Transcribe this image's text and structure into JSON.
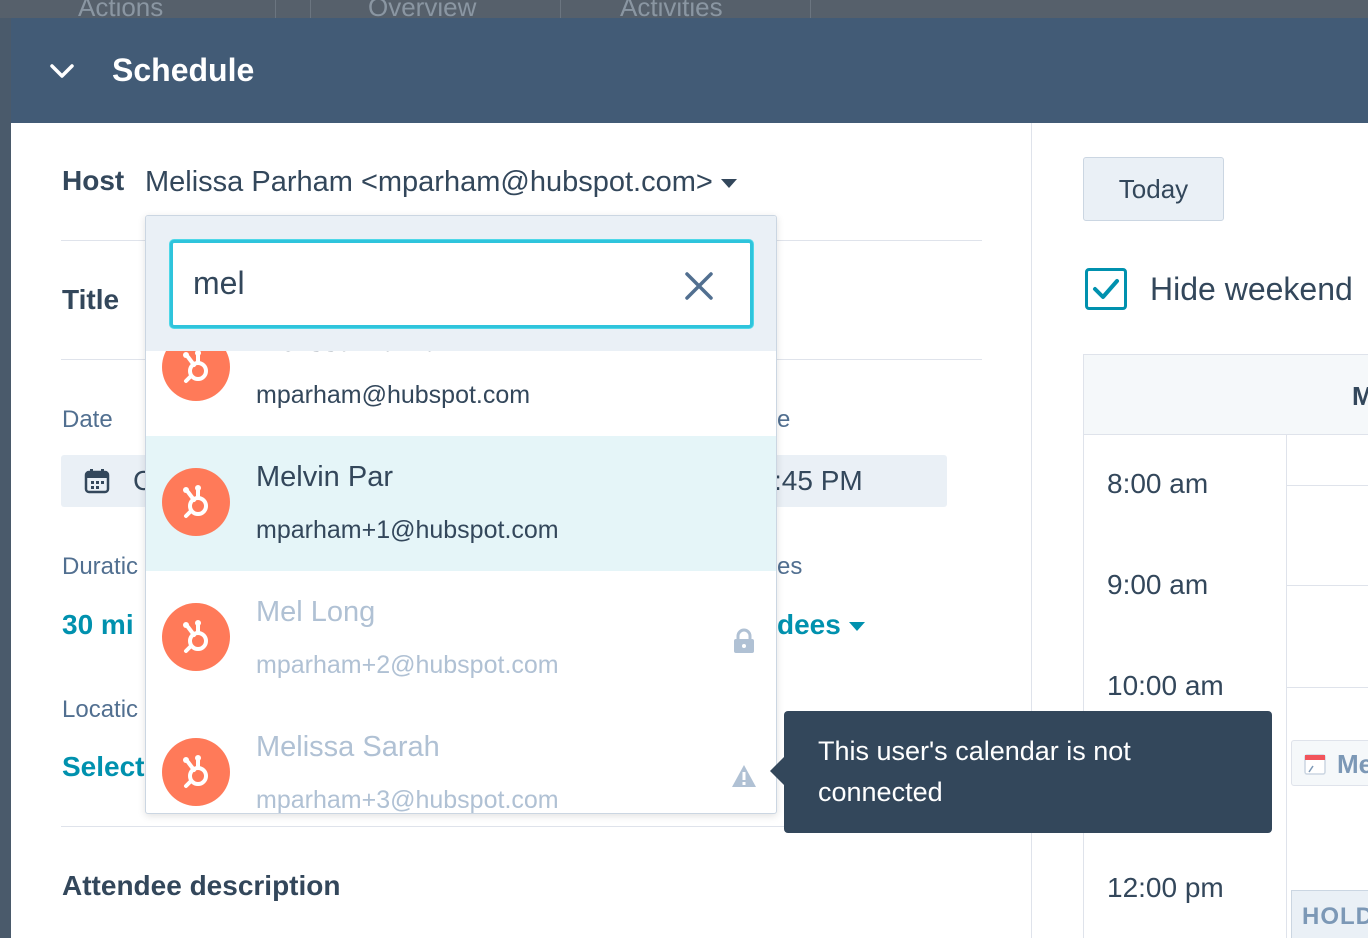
{
  "background_tabs": [
    "Actions",
    "Overview",
    "Activities"
  ],
  "modal": {
    "title": "Schedule",
    "collapse_icon": "chevron-down-icon"
  },
  "form": {
    "host_label": "Host",
    "host_value": "Melissa Parham <mparham@hubspot.com>",
    "title_label": "Title",
    "date_label": "Date",
    "time_label_partial": "e",
    "date_value_partial": "C",
    "time_value_partial": ":45 PM",
    "duration_label": "Duratic",
    "duration_value": "30 mi",
    "attendees_label_partial": "es",
    "attendees_value_partial": "dees",
    "location_label": "Locatic",
    "location_value": "Select",
    "attendee_description_label": "Attendee description"
  },
  "host_dropdown": {
    "search_value": "mel",
    "options": [
      {
        "name": "Melissa Parham",
        "email": "mparham@hubspot.com",
        "state": "normal",
        "status_icon": ""
      },
      {
        "name": "Melvin Par",
        "email": "mparham+1@hubspot.com",
        "state": "highlighted",
        "status_icon": ""
      },
      {
        "name": "Mel Long",
        "email": "mparham+2@hubspot.com",
        "state": "disabled",
        "status_icon": "lock-icon"
      },
      {
        "name": "Melissa Sarah",
        "email": "mparham+3@hubspot.com",
        "state": "disabled",
        "status_icon": "warning-icon"
      }
    ]
  },
  "tooltip": {
    "text": "This user's calendar is not connected"
  },
  "calendar": {
    "today_button": "Today",
    "hide_weekends_label": "Hide weekend",
    "hide_weekends_checked": true,
    "day_header_partial": "M",
    "time_slots": [
      "8:00 am",
      "9:00 am",
      "10:00 am",
      "12:00 pm"
    ],
    "event_label_partial": "Me",
    "hold_label_partial": "HOLD"
  },
  "colors": {
    "header_bg": "#425b76",
    "accent_teal": "#0091ae",
    "avatar_orange": "#ff7a59",
    "tooltip_bg": "#33475b",
    "highlight_row": "#e5f5f8"
  }
}
